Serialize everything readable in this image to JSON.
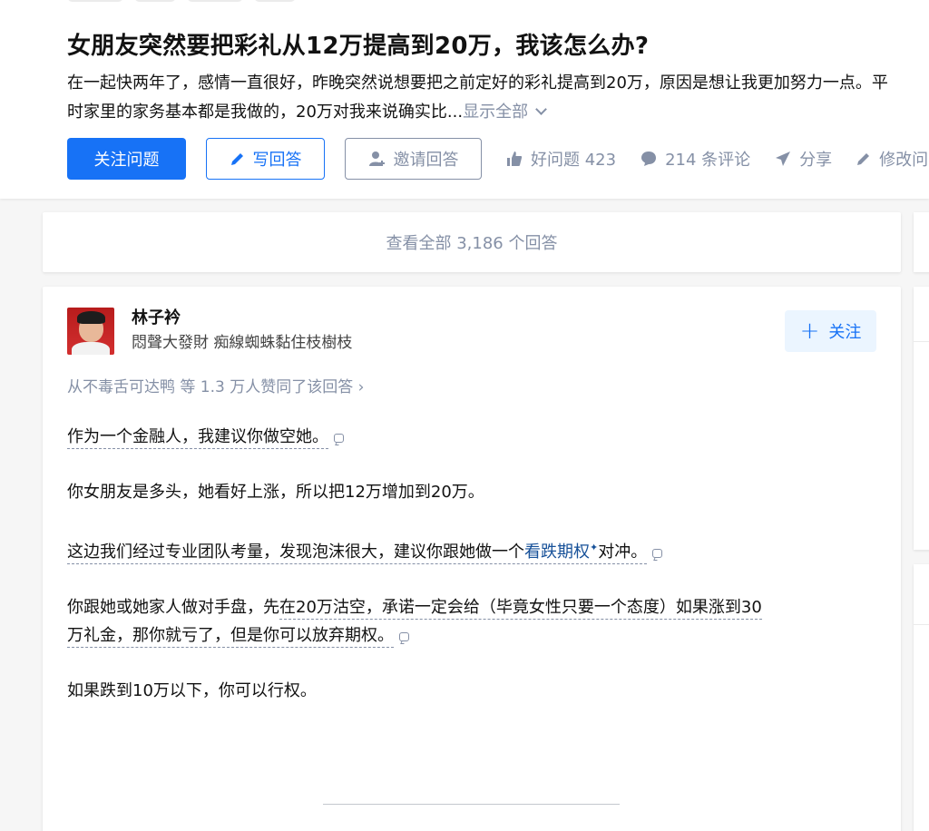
{
  "question": {
    "title": "女朋友突然要把彩礼从12万提高到20万，我该怎么办?",
    "description": "在一起快两年了，感情一直很好，昨晚突然说想要把之前定好的彩礼提高到20万，原因是想让我更加努力一点。平时家里的家务基本都是我做的，20万对我来说确实比...",
    "show_all": "显示全部"
  },
  "actions": {
    "follow_question": "关注问题",
    "write_answer": "写回答",
    "invite_answer": "邀请回答",
    "good_question": "好问题 423",
    "comments": "214 条评论",
    "share": "分享",
    "edit": "修改问"
  },
  "view_all": "查看全部 3,186 个回答",
  "answer": {
    "author_name": "林子衿",
    "author_signature": "悶聲大發財 痴線蜘蛛黏住枝樹枝",
    "follow_label": "关注",
    "voters": "从不毒舌可达鸭 等 1.3 万人赞同了该回答 ›",
    "p1": "作为一个金融人，我建议你做空她。",
    "p2": "你女朋友是多头，她看好上涨，所以把12万增加到20万。",
    "p3_before": "这边我们经过专业团队考量，发现泡沫很大，建议你跟她做一个",
    "p3_link": "看跌期权",
    "p3_after": "对冲。",
    "p4_plain": "你跟她或她家人做对手盘，先",
    "p4_underlined_a": "在20万沽空，承诺一定会给（毕竟女性只要一个态度）如果涨到30",
    "p4_underlined_b": "万礼金，那你就亏了，但是你可以放弃期权。",
    "p5": "如果跌到10万以下，你可以行权。"
  },
  "colors": {
    "brand_blue": "#1772f6",
    "gray_text": "#8590a6",
    "link_blue": "#175199"
  }
}
